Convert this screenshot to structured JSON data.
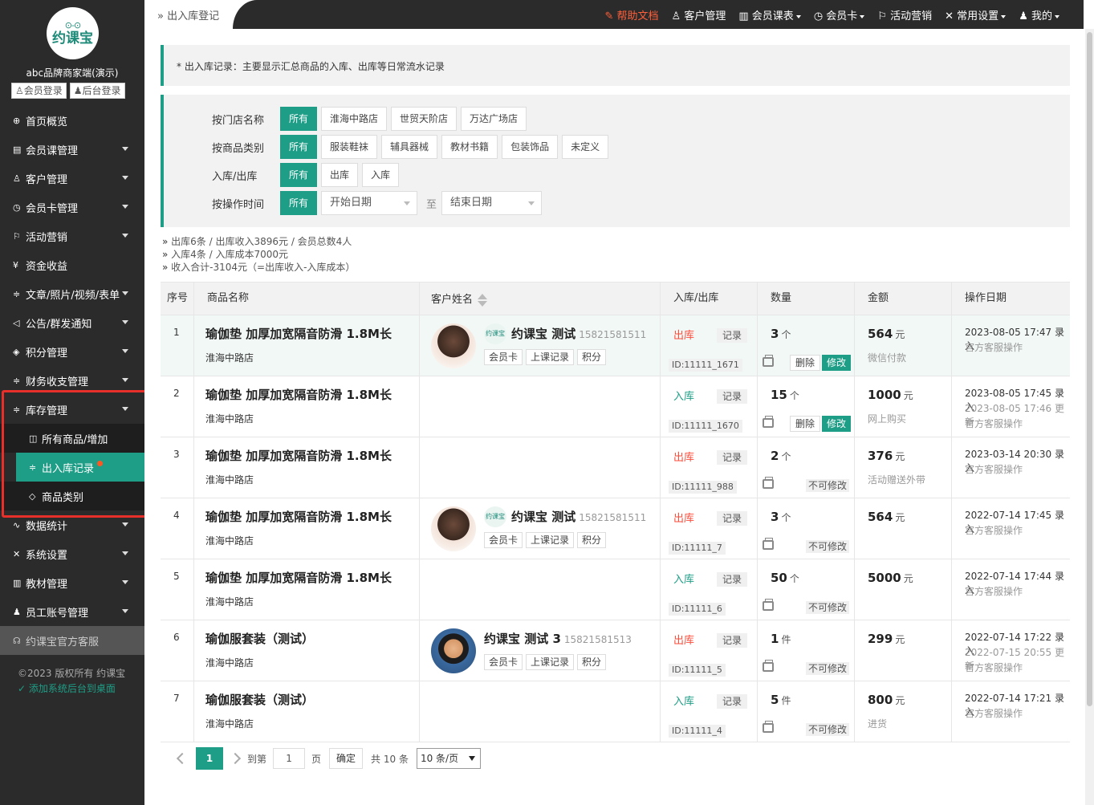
{
  "brand": {
    "logo_text": "约课宝",
    "logo_glasses": "⊙-⊙",
    "name": "abc品牌商家端(演示)",
    "member_login": "会员登录",
    "admin_login": "后台登录"
  },
  "sidebar": {
    "items": [
      {
        "label": "首页概览",
        "icon": "globe-icon",
        "glyph": "⊕",
        "arrow": false
      },
      {
        "label": "会员课管理",
        "icon": "doc-icon",
        "glyph": "▤",
        "arrow": true
      },
      {
        "label": "客户管理",
        "icon": "user-icon",
        "glyph": "♙",
        "arrow": true
      },
      {
        "label": "会员卡管理",
        "icon": "clock-icon",
        "glyph": "◷",
        "arrow": true
      },
      {
        "label": "活动营销",
        "icon": "flag-icon",
        "glyph": "⚐",
        "arrow": true
      },
      {
        "label": "资金收益",
        "icon": "yen-icon",
        "glyph": "¥",
        "arrow": false
      },
      {
        "label": "文章/照片/视频/表单",
        "icon": "sliders-icon",
        "glyph": "≑",
        "arrow": true
      },
      {
        "label": "公告/群发通知",
        "icon": "speaker-icon",
        "glyph": "◁",
        "arrow": true
      },
      {
        "label": "积分管理",
        "icon": "diamond-icon",
        "glyph": "◈",
        "arrow": true
      },
      {
        "label": "财务收支管理",
        "icon": "sliders-icon",
        "glyph": "≑",
        "arrow": true
      },
      {
        "label": "库存管理",
        "icon": "sliders-icon",
        "glyph": "≑",
        "arrow": true
      }
    ],
    "sub_items": [
      {
        "label": "所有商品/增加",
        "icon": "layers-icon",
        "glyph": "◫"
      },
      {
        "label": "出入库记录",
        "icon": "sliders-icon",
        "glyph": "≑"
      },
      {
        "label": "商品类别",
        "icon": "tag-icon",
        "glyph": "◇"
      }
    ],
    "items_after": [
      {
        "label": "数据统计",
        "icon": "chart-icon",
        "glyph": "∿",
        "arrow": true
      },
      {
        "label": "系统设置",
        "icon": "tools-icon",
        "glyph": "✕",
        "arrow": true
      },
      {
        "label": "教材管理",
        "icon": "book-icon",
        "glyph": "▥",
        "arrow": true
      },
      {
        "label": "员工账号管理",
        "icon": "person-icon",
        "glyph": "♟",
        "arrow": true
      }
    ],
    "service": "约课宝官方客服",
    "copyright": "©2023 版权所有 约课宝",
    "add_desktop": "添加系统后台到桌面"
  },
  "topbar": {
    "breadcrumb": "出入库登记",
    "nav": [
      {
        "label": "帮助文档",
        "icon": "help-icon",
        "glyph": "✎",
        "caret": false,
        "help": true
      },
      {
        "label": "客户管理",
        "icon": "user-icon",
        "glyph": "♙",
        "caret": false,
        "help": false
      },
      {
        "label": "会员课表",
        "icon": "book-icon",
        "glyph": "▥",
        "caret": true,
        "help": false
      },
      {
        "label": "会员卡",
        "icon": "clock-icon",
        "glyph": "◷",
        "caret": true,
        "help": false
      },
      {
        "label": "活动营销",
        "icon": "flag-icon",
        "glyph": "⚐",
        "caret": false,
        "help": false
      },
      {
        "label": "常用设置",
        "icon": "tools-icon",
        "glyph": "✕",
        "caret": true,
        "help": false
      },
      {
        "label": "我的",
        "icon": "person-icon",
        "glyph": "♟",
        "caret": true,
        "help": false
      }
    ]
  },
  "notice": "* 出入库记录：主要显示汇总商品的入库、出库等日常流水记录",
  "filters": {
    "store": {
      "label": "按门店名称",
      "options": [
        "所有",
        "淮海中路店",
        "世贸天阶店",
        "万达广场店"
      ]
    },
    "category": {
      "label": "按商品类别",
      "options": [
        "所有",
        "服装鞋袜",
        "辅具器械",
        "教材书籍",
        "包装饰品",
        "未定义"
      ]
    },
    "direction": {
      "label": "入库/出库",
      "options": [
        "所有",
        "出库",
        "入库"
      ]
    },
    "time": {
      "label": "按操作时间",
      "all": "所有",
      "start": "开始日期",
      "to": "至",
      "end": "结束日期"
    }
  },
  "summary": {
    "line1": "出库6条 / 出库收入3896元 / 会员总数4人",
    "line2": "入库4条 / 入库成本7000元",
    "line3": "收入合计-3104元（=出库收入-入库成本）"
  },
  "table": {
    "headers": [
      "序号",
      "商品名称",
      "客户姓名",
      "入库/出库",
      "数量",
      "金额",
      "操作日期"
    ],
    "rows": [
      {
        "seq": "1",
        "name": "瑜伽垫 加厚加宽隔音防滑 1.8M长",
        "store": "淮海中路店",
        "customer": {
          "name": "约课宝 测试",
          "phone": "15821581511",
          "avatar": "woman",
          "logo": true
        },
        "io": "出库",
        "type": "out",
        "record": "记录",
        "id": "ID:11111_1671",
        "qty": "3",
        "unit": "个",
        "editable": true,
        "amount": "564",
        "currency": "元",
        "pay": "微信付款",
        "dates": [
          "2023-08-05 17:47 录入",
          "官方客服操作"
        ],
        "highlight": true
      },
      {
        "seq": "2",
        "name": "瑜伽垫 加厚加宽隔音防滑 1.8M长",
        "store": "淮海中路店",
        "customer": null,
        "io": "入库",
        "type": "in",
        "record": "记录",
        "id": "ID:11111_1670",
        "qty": "15",
        "unit": "个",
        "editable": true,
        "amount": "1000",
        "currency": "元",
        "pay": "网上购买",
        "dates": [
          "2023-08-05 17:45 录入",
          "2023-08-05 17:46 更新",
          "官方客服操作"
        ]
      },
      {
        "seq": "3",
        "name": "瑜伽垫 加厚加宽隔音防滑 1.8M长",
        "store": "淮海中路店",
        "customer": null,
        "io": "出库",
        "type": "out",
        "record": "记录",
        "id": "ID:11111_988",
        "qty": "2",
        "unit": "个",
        "editable": false,
        "amount": "376",
        "currency": "元",
        "pay": "活动赠送外带",
        "dates": [
          "2023-03-14 20:30 录入",
          "官方客服操作"
        ]
      },
      {
        "seq": "4",
        "name": "瑜伽垫 加厚加宽隔音防滑 1.8M长",
        "store": "淮海中路店",
        "customer": {
          "name": "约课宝 测试",
          "phone": "15821581511",
          "avatar": "woman",
          "logo": true
        },
        "io": "出库",
        "type": "out",
        "record": "记录",
        "id": "ID:11111_7",
        "qty": "3",
        "unit": "个",
        "editable": false,
        "amount": "564",
        "currency": "元",
        "pay": "",
        "dates": [
          "2022-07-14 17:45 录入",
          "官方客服操作"
        ]
      },
      {
        "seq": "5",
        "name": "瑜伽垫 加厚加宽隔音防滑 1.8M长",
        "store": "淮海中路店",
        "customer": null,
        "io": "入库",
        "type": "in",
        "record": "记录",
        "id": "ID:11111_6",
        "qty": "50",
        "unit": "个",
        "editable": false,
        "amount": "5000",
        "currency": "元",
        "pay": "",
        "dates": [
          "2022-07-14 17:44 录入",
          "官方客服操作"
        ]
      },
      {
        "seq": "6",
        "name": "瑜伽服套装（测试）",
        "store": "淮海中路店",
        "customer": {
          "name": "约课宝 测试 3",
          "phone": "15821581513",
          "avatar": "man",
          "logo": false
        },
        "io": "出库",
        "type": "out",
        "record": "记录",
        "id": "ID:11111_5",
        "qty": "1",
        "unit": "件",
        "editable": false,
        "amount": "299",
        "currency": "元",
        "pay": "",
        "dates": [
          "2022-07-14 17:22 录入",
          "2022-07-15 20:55 更新",
          "官方客服操作"
        ]
      },
      {
        "seq": "7",
        "name": "瑜伽服套装（测试）",
        "store": "淮海中路店",
        "customer": null,
        "io": "入库",
        "type": "in",
        "record": "记录",
        "id": "ID:11111_4",
        "qty": "5",
        "unit": "件",
        "editable": false,
        "amount": "800",
        "currency": "元",
        "pay": "进货",
        "dates": [
          "2022-07-14 17:21 录入",
          "官方客服操作"
        ]
      }
    ],
    "customer_tags": [
      "会员卡",
      "上课记录",
      "积分"
    ],
    "delete_label": "删除",
    "modify_label": "修改",
    "nomod_label": "不可修改",
    "logo_text": "约课宝"
  },
  "pager": {
    "current": "1",
    "goto": "到第",
    "page_input": "1",
    "page_word": "页",
    "confirm": "确定",
    "total": "共 10 条",
    "per_page": "10 条/页"
  },
  "colors": {
    "accent": "#1e9e86",
    "out": "#ff4b3a",
    "sidebar": "#2b2b2b",
    "highlight_box": "#e8302a"
  }
}
